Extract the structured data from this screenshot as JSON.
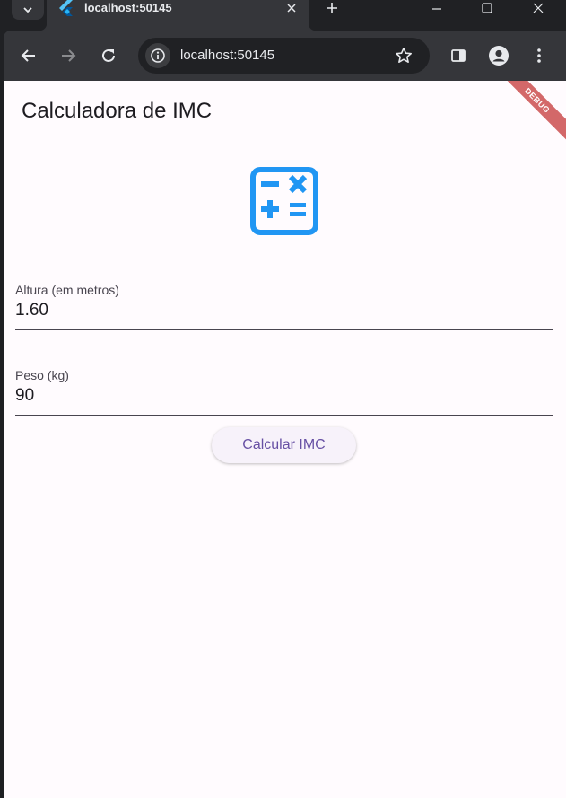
{
  "browser": {
    "tab_title": "localhost:50145",
    "url": "localhost:50145"
  },
  "app": {
    "title": "Calculadora de IMC",
    "debug_banner": "DEBUG",
    "icon": "calculate-icon",
    "accent_color": "#2196f3",
    "fields": [
      {
        "label": "Altura (em metros)",
        "value": "1.60"
      },
      {
        "label": "Peso (kg)",
        "value": "90"
      }
    ],
    "button_label": "Calcular IMC"
  }
}
